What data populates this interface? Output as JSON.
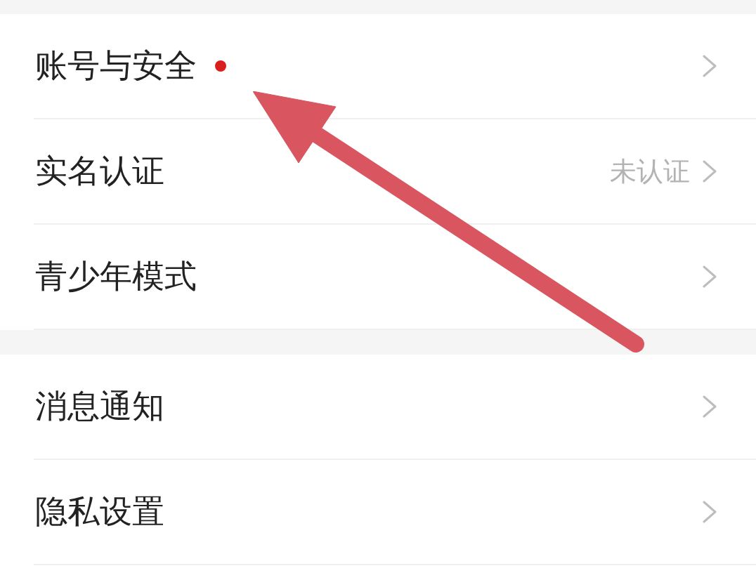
{
  "groups": [
    {
      "items": [
        {
          "label": "账号与安全",
          "dot": true
        },
        {
          "label": "实名认证",
          "dot": false,
          "status": "未认证"
        },
        {
          "label": "青少年模式",
          "dot": false
        }
      ]
    },
    {
      "items": [
        {
          "label": "消息通知",
          "dot": false
        },
        {
          "label": "隐私设置",
          "dot": false
        }
      ]
    }
  ]
}
